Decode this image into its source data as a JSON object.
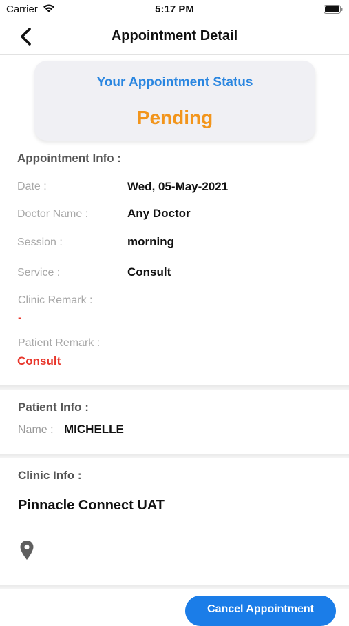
{
  "status_bar": {
    "carrier": "Carrier",
    "time": "5:17 PM"
  },
  "nav": {
    "title": "Appointment Detail"
  },
  "status_card": {
    "heading": "Your Appointment Status",
    "value": "Pending",
    "value_color": "#f2951c",
    "heading_color": "#2a86e0"
  },
  "appointment_info": {
    "title": "Appointment Info :",
    "date_label": "Date :",
    "date_value": "Wed, 05-May-2021",
    "doctor_label": "Doctor Name :",
    "doctor_value": "Any Doctor",
    "session_label": "Session :",
    "session_value": "morning",
    "service_label": "Service :",
    "service_value": "Consult",
    "clinic_remark_label": "Clinic Remark :",
    "clinic_remark_value": "-",
    "patient_remark_label": "Patient Remark :",
    "patient_remark_value": "Consult"
  },
  "patient_info": {
    "title": "Patient Info :",
    "name_label": "Name :",
    "name_value": "MICHELLE"
  },
  "clinic_info": {
    "title": "Clinic Info :",
    "clinic_name": "Pinnacle Connect UAT"
  },
  "actions": {
    "cancel_label": "Cancel Appointment",
    "accent": "#1b7de8"
  }
}
